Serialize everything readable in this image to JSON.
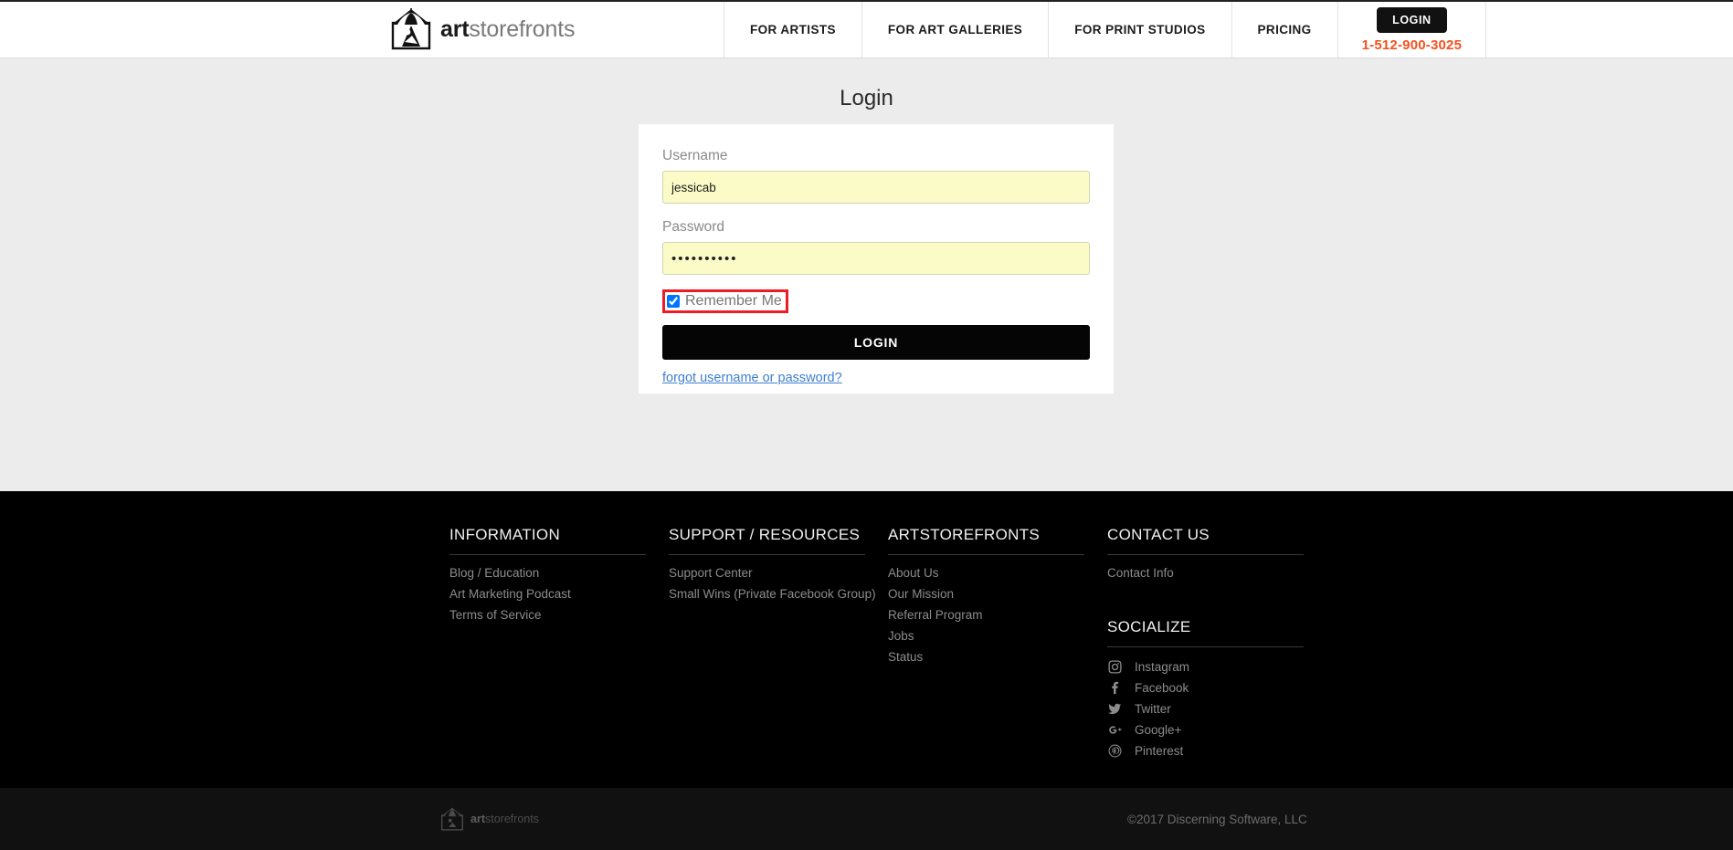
{
  "header": {
    "brand": {
      "prefix": "art",
      "suffix": "storefronts",
      "logo_icon": "art-gallery-house-logo"
    },
    "nav_items": [
      {
        "label": "FOR ARTISTS"
      },
      {
        "label": "FOR ART GALLERIES"
      },
      {
        "label": "FOR PRINT STUDIOS"
      },
      {
        "label": "PRICING"
      }
    ],
    "login_button": "LOGIN",
    "phone": "1-512-900-3025",
    "phone_color": "#f4511e"
  },
  "main": {
    "title": "Login",
    "username": {
      "label": "Username",
      "value": "jessicab",
      "placeholder": ""
    },
    "password": {
      "label": "Password",
      "value": "••••••••••",
      "placeholder": ""
    },
    "remember": {
      "label": "Remember Me",
      "checked": true,
      "highlight_color": "#ee1c25"
    },
    "submit_label": "LOGIN",
    "forgot_link": "forgot username or password?"
  },
  "footer": {
    "columns": [
      {
        "title": "INFORMATION",
        "links": [
          "Blog / Education",
          "Art Marketing Podcast",
          "Terms of Service"
        ]
      },
      {
        "title": "SUPPORT / RESOURCES",
        "links": [
          "Support Center",
          "Small Wins (Private Facebook Group)"
        ]
      },
      {
        "title": "ARTSTOREFRONTS",
        "links": [
          "About Us",
          "Our Mission",
          "Referral Program",
          "Jobs",
          "Status"
        ]
      },
      {
        "title": "CONTACT US",
        "links": [
          "Contact Info"
        ]
      }
    ],
    "socialize_title": "SOCIALIZE",
    "social": [
      {
        "label": "Instagram",
        "icon": "instagram-icon"
      },
      {
        "label": "Facebook",
        "icon": "facebook-icon"
      },
      {
        "label": "Twitter",
        "icon": "twitter-icon"
      },
      {
        "label": "Google+",
        "icon": "google-plus-icon"
      },
      {
        "label": "Pinterest",
        "icon": "pinterest-icon"
      }
    ]
  },
  "bottombar": {
    "brand": {
      "prefix": "art",
      "suffix": "storefronts",
      "logo_icon": "art-gallery-house-logo"
    },
    "copyright": "©2017 Discerning Software, LLC"
  }
}
